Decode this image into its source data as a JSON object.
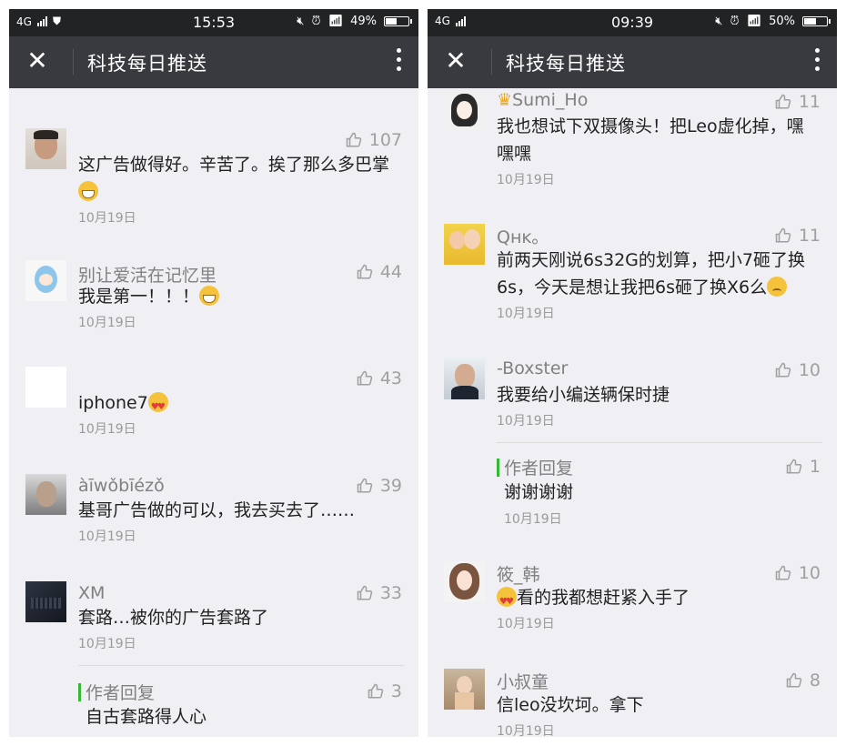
{
  "left": {
    "status": {
      "network": "4G",
      "time": "15:53",
      "battery": "49%",
      "battery_level": 0.49
    },
    "title": "科技每日推送",
    "comments": [
      {
        "name": "",
        "likes": "107",
        "text": "这广告做得好。辛苦了。挨了那么多巴掌",
        "date": "10月19日"
      },
      {
        "name": "别让爱活在记忆里",
        "likes": "44",
        "text": "我是第一！！！",
        "date": "10月19日"
      },
      {
        "name": "",
        "likes": "43",
        "text": "iphone7",
        "date": "10月19日"
      },
      {
        "name": "àīwǒbīézǒ",
        "likes": "39",
        "text": "基哥广告做的可以，我去买去了……",
        "date": "10月19日"
      },
      {
        "name": "XM",
        "likes": "33",
        "text": "套路…被你的广告套路了",
        "date": "10月19日"
      }
    ],
    "reply": {
      "label": "作者回复",
      "likes": "3",
      "text": "自古套路得人心"
    }
  },
  "right": {
    "status": {
      "network": "4G",
      "time": "09:39",
      "battery": "50%",
      "battery_level": 0.5
    },
    "title": "科技每日推送",
    "comments": [
      {
        "name": "Sumi_Ho",
        "likes": "11",
        "text": "我也想试下双摄像头！把Leo虚化掉，嘿嘿嘿",
        "date": "10月19日"
      },
      {
        "name": "Qʜᴋ。",
        "likes": "11",
        "text": "前两天刚说6s32G的划算，把小7砸了换6s，今天是想让我把6s砸了换X6么",
        "date": "10月19日"
      },
      {
        "name": "-Boxster",
        "likes": "10",
        "text": "我要给小编送辆保时捷",
        "date": "10月19日"
      },
      {
        "name": "筱_韩",
        "likes": "10",
        "text": "看的我都想赶紧入手了",
        "date": "10月19日"
      },
      {
        "name": "小叔童",
        "likes": "8",
        "text": "信leo没坎坷。拿下",
        "date": "10月19日"
      }
    ],
    "reply": {
      "label": "作者回复",
      "likes": "1",
      "text": "谢谢谢谢",
      "date": "10月19日"
    }
  },
  "colors": {
    "navbar": "#393a3f",
    "statusbar": "#222325",
    "background": "#efeff4",
    "reply_accent": "#35b934"
  },
  "icons": {
    "close": "close-icon",
    "more": "more-vertical-icon",
    "like": "thumbs-up-icon"
  }
}
